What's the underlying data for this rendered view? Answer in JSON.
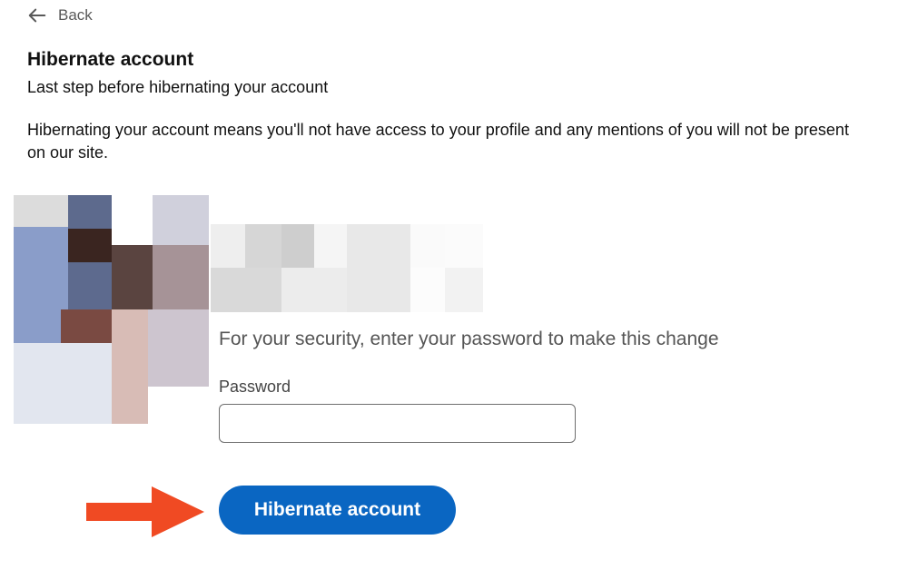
{
  "nav": {
    "back_label": "Back",
    "back_icon": "arrow-left-icon"
  },
  "header": {
    "title": "Hibernate account",
    "subtitle": "Last step before hibernating your account"
  },
  "main": {
    "description": "Hibernating your account means you'll not have access to your profile and any mentions of you will not be present on our site.",
    "security_prompt": "For your security, enter your password to make this change",
    "password_label": "Password",
    "password_value": "",
    "hibernate_button_label": "Hibernate account"
  },
  "colors": {
    "primary_button": "#0a66c2",
    "annotation_arrow": "#f04a23"
  }
}
